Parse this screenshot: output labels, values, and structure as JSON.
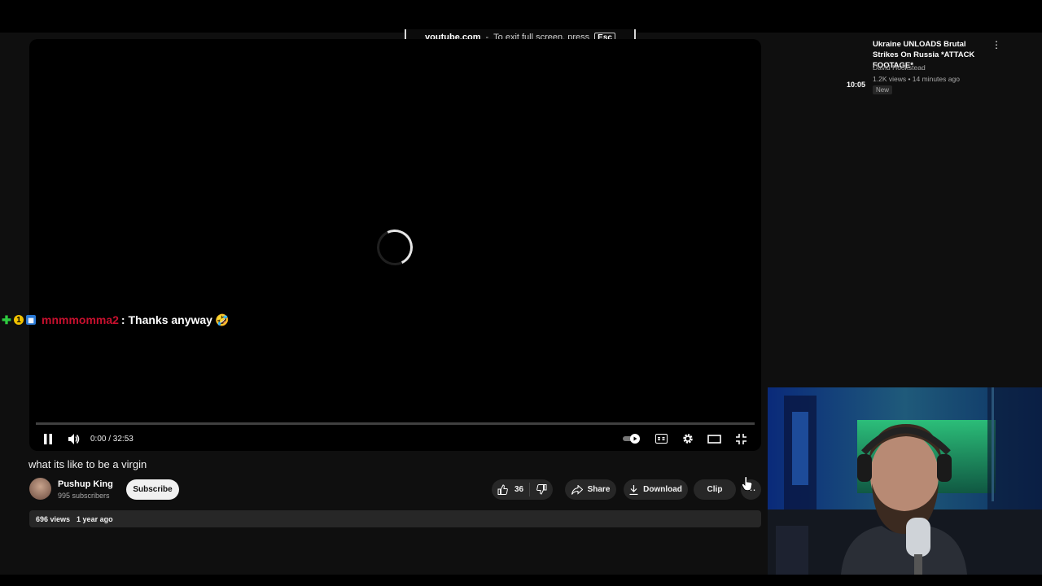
{
  "fullscreen_notice": {
    "domain": "youtube.com",
    "text": "To exit full screen, press",
    "key": "Esc"
  },
  "player": {
    "time": "0:00 / 32:53",
    "progress": 0
  },
  "chat": {
    "username": "mnmmomma2",
    "message": ": Thanks anyway"
  },
  "video": {
    "title": "what its like to be a virgin",
    "channel_name": "Pushup King",
    "subscribers": "995 subscribers",
    "subscribe_label": "Subscribe",
    "like_count": "36",
    "share_label": "Share",
    "download_label": "Download",
    "clip_label": "Clip",
    "views": "696 views",
    "age": "1 year ago"
  },
  "recommended": {
    "title": "Ukraine UNLOADS Brutal Strikes On Russia *ATTACK FOOTAGE*",
    "duration": "10:05",
    "channel": "David Hookstead",
    "meta": "1.2K views • 14 minutes ago",
    "badge": "New"
  }
}
